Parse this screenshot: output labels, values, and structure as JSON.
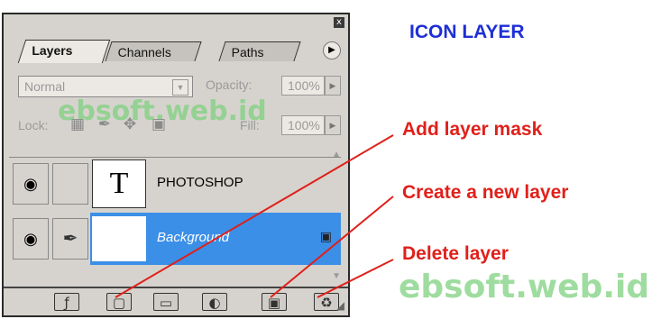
{
  "panel": {
    "close": "x",
    "tabs": [
      {
        "label": "Layers",
        "active": true
      },
      {
        "label": "Channels",
        "active": false
      },
      {
        "label": "Paths",
        "active": false
      }
    ],
    "blend_mode": "Normal",
    "opacity_label": "Opacity:",
    "opacity_value": "100%",
    "lock_label": "Lock:",
    "fill_label": "Fill:",
    "fill_value": "100%",
    "layers": [
      {
        "name": "PHOTOSHOP",
        "thumb": "T",
        "selected": false
      },
      {
        "name": "Background",
        "thumb": "",
        "selected": true
      }
    ]
  },
  "annotations": {
    "title": "ICON LAYER",
    "add_mask": "Add layer mask",
    "new_layer": "Create a new layer",
    "delete_layer": "Delete layer",
    "title_color": "#1d2fd6",
    "label_color": "#e0201a"
  },
  "watermark": "ebsoft.web.id"
}
